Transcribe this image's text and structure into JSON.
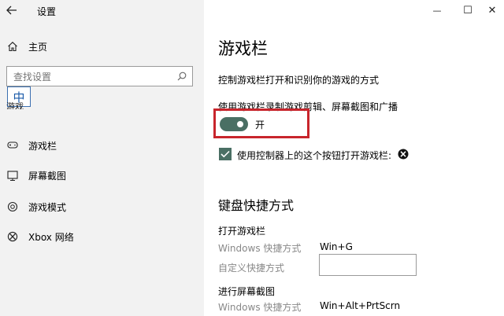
{
  "window": {
    "title": "设置",
    "back_icon": "arrow-left-icon",
    "minimize_glyph": "—",
    "maximize_glyph": "☐",
    "close_glyph": "✕"
  },
  "sidebar": {
    "home_label": "主页",
    "search_placeholder": "查找设置",
    "ime_label": "中",
    "section_label": "游戏",
    "items": [
      {
        "label": "游戏栏",
        "icon": "game-bar-icon"
      },
      {
        "label": "屏幕截图",
        "icon": "screenshot-icon"
      },
      {
        "label": "游戏模式",
        "icon": "game-mode-icon"
      },
      {
        "label": "Xbox 网络",
        "icon": "xbox-icon"
      }
    ]
  },
  "main": {
    "title": "游戏栏",
    "description": "控制游戏栏打开和识别你的游戏的方式",
    "record_setting_label": "使用游戏栏录制游戏剪辑、屏幕截图和广播",
    "toggle_state_label": "开",
    "checkbox_label": "使用控制器上的这个按钮打开游戏栏:",
    "keyboard_section_title": "键盘快捷方式",
    "shortcuts": [
      {
        "group_title": "打开游戏栏",
        "windows_label": "Windows 快捷方式",
        "windows_value": "Win+G",
        "custom_label": "自定义快捷方式",
        "custom_value": ""
      },
      {
        "group_title": "进行屏幕截图",
        "windows_label": "Windows 快捷方式",
        "windows_value": "Win+Alt+PrtScrn"
      }
    ]
  },
  "colors": {
    "toggle_on": "#4a6f64",
    "highlight_border": "#c8252c",
    "sidebar_bg": "#f2f2f2"
  }
}
